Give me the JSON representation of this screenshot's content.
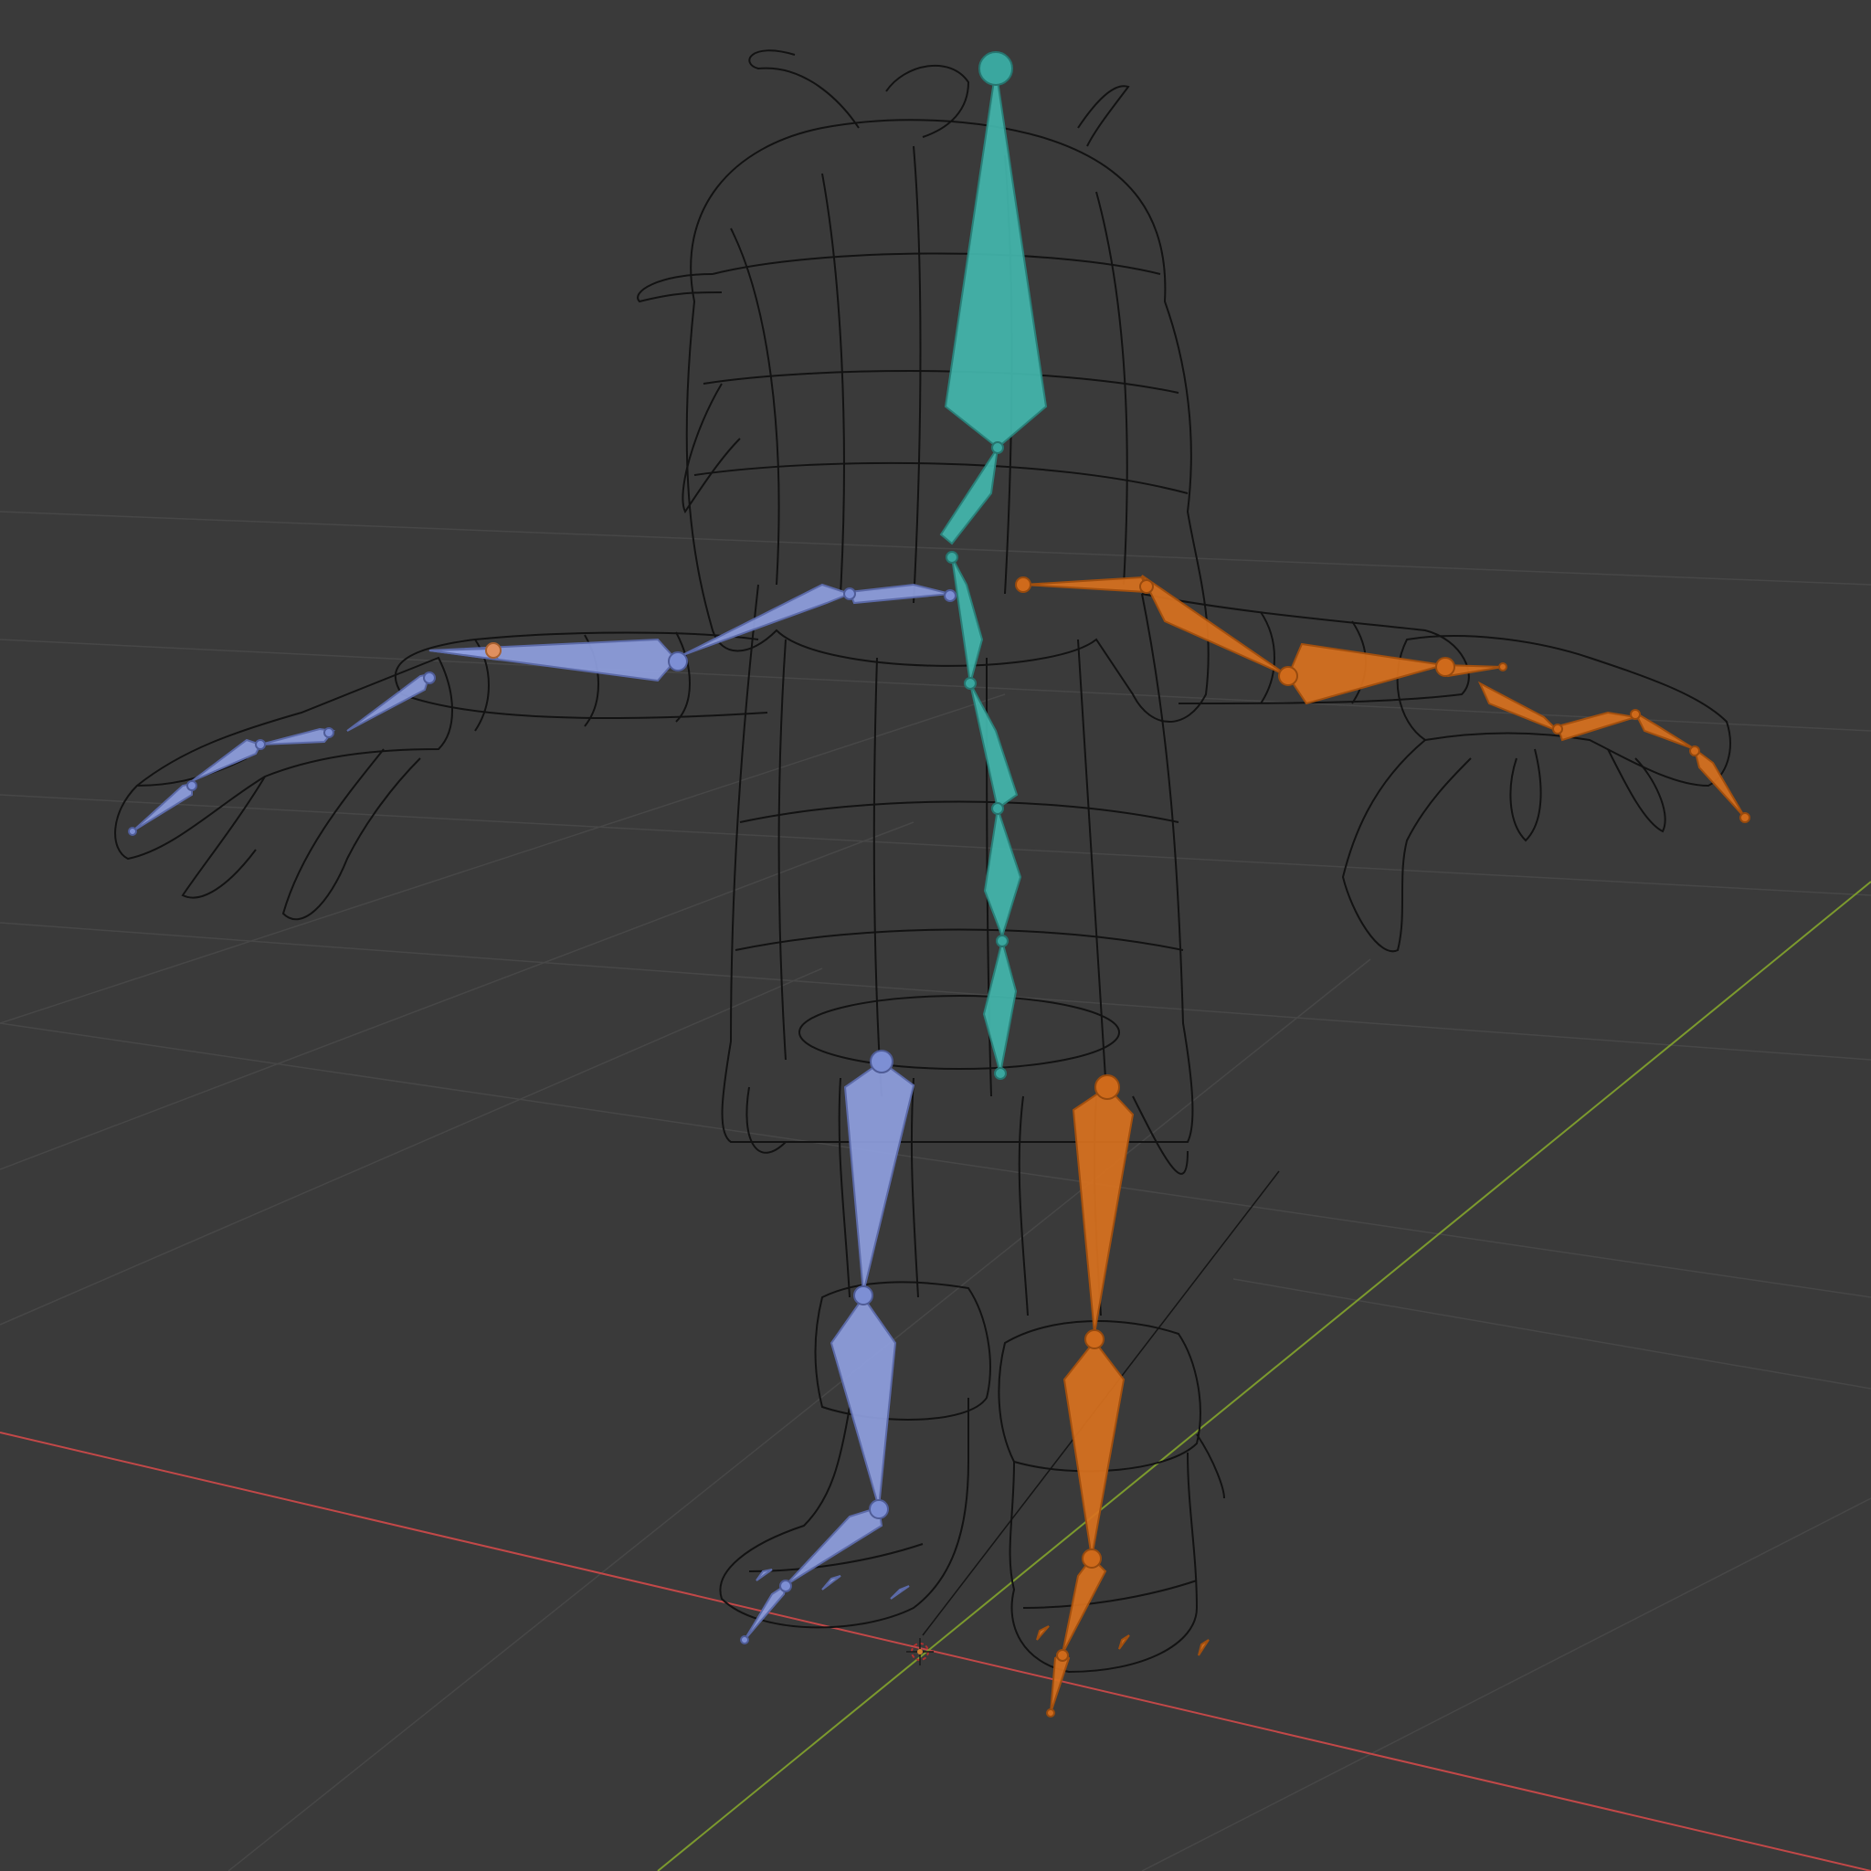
{
  "viewport": {
    "background_color": "#3a3a3a",
    "grid_color": "#474747",
    "x_axis_color": "#c24848",
    "y_axis_color": "#7c9a2e",
    "wireframe_color": "#121212",
    "bone_colors": {
      "center": "#43b7ae",
      "left": "#8fa0e0",
      "right": "#d9721f"
    },
    "origin_icon": "3d-cursor-icon"
  }
}
